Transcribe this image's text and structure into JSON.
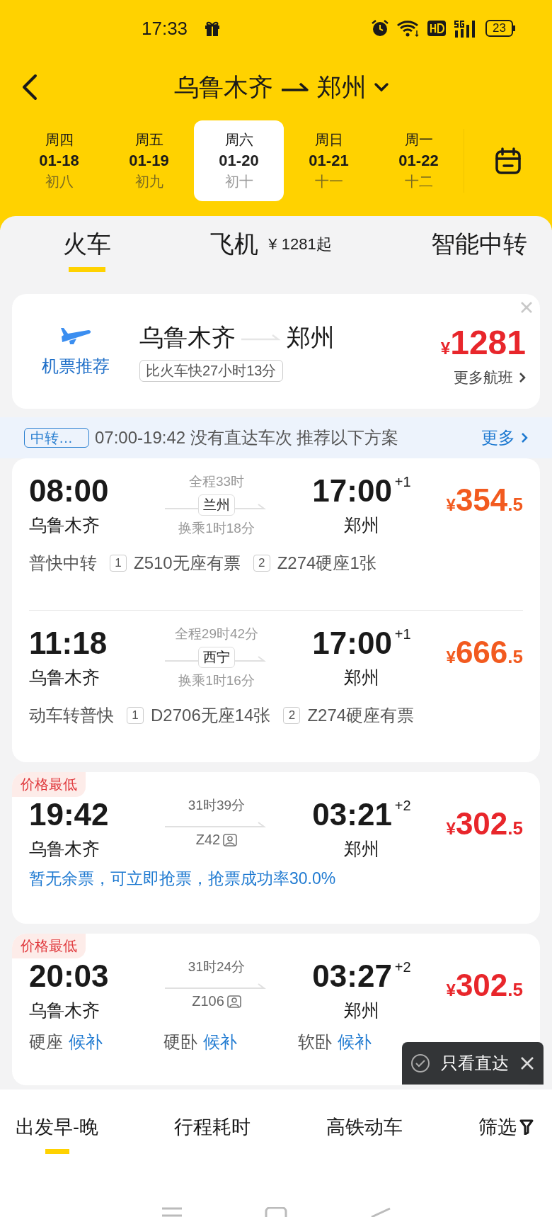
{
  "status_bar": {
    "time": "17:33",
    "battery": "23"
  },
  "header": {
    "from": "乌鲁木齐",
    "to": "郑州"
  },
  "dates": [
    {
      "weekday": "周四",
      "date": "01-18",
      "lunar": "初八",
      "selected": false
    },
    {
      "weekday": "周五",
      "date": "01-19",
      "lunar": "初九",
      "selected": false
    },
    {
      "weekday": "周六",
      "date": "01-20",
      "lunar": "初十",
      "selected": true
    },
    {
      "weekday": "周日",
      "date": "01-21",
      "lunar": "十一",
      "selected": false
    },
    {
      "weekday": "周一",
      "date": "01-22",
      "lunar": "十二",
      "selected": false
    }
  ],
  "mode_tabs": [
    {
      "label": "火车",
      "selected": true
    },
    {
      "label": "飞机",
      "note": "¥ 1281起",
      "selected": false
    },
    {
      "label": "智能中转",
      "selected": false
    }
  ],
  "flight_card": {
    "label": "机票推荐",
    "from": "乌鲁木齐",
    "to": "郑州",
    "badge": "比火车快27小时13分",
    "currency": "¥",
    "price": "1281",
    "more": "更多航班"
  },
  "transfer_notice": {
    "tag": "中转…",
    "text": "07:00-19:42 没有直达车次 推荐以下方案",
    "more": "更多"
  },
  "transfer_options": [
    {
      "depart_time": "08:00",
      "depart_station": "乌鲁木齐",
      "total": "全程33时",
      "via": "兰州",
      "transfer_time": "换乘1时18分",
      "arrive_time": "17:00",
      "day_offset": "+1",
      "arrive_station": "郑州",
      "currency": "¥",
      "price": "354",
      "price_decimal": ".5",
      "type": "普快中转",
      "legs": [
        {
          "index": "1",
          "text": "Z510无座有票"
        },
        {
          "index": "2",
          "text": "Z274硬座1张"
        }
      ]
    },
    {
      "depart_time": "11:18",
      "depart_station": "乌鲁木齐",
      "total": "全程29时42分",
      "via": "西宁",
      "transfer_time": "换乘1时16分",
      "arrive_time": "17:00",
      "day_offset": "+1",
      "arrive_station": "郑州",
      "currency": "¥",
      "price": "666",
      "price_decimal": ".5",
      "type": "动车转普快",
      "legs": [
        {
          "index": "1",
          "text": "D2706无座14张"
        },
        {
          "index": "2",
          "text": "Z274硬座有票"
        }
      ]
    }
  ],
  "trains": [
    {
      "badge": "价格最低",
      "depart_time": "19:42",
      "depart_station": "乌鲁木齐",
      "duration": "31时39分",
      "train_no": "Z42",
      "arrive_time": "03:21",
      "day_offset": "+2",
      "arrive_station": "郑州",
      "currency": "¥",
      "price": "302",
      "price_decimal": ".5",
      "kind": "notice",
      "notice": "暂无余票，可立即抢票，抢票成功率30.0%"
    },
    {
      "badge": "价格最低",
      "depart_time": "20:03",
      "depart_station": "乌鲁木齐",
      "duration": "31时24分",
      "train_no": "Z106",
      "arrive_time": "03:27",
      "day_offset": "+2",
      "arrive_station": "郑州",
      "currency": "¥",
      "price": "302",
      "price_decimal": ".5",
      "kind": "seats",
      "seats": [
        {
          "class": "硬座",
          "status": "候补"
        },
        {
          "class": "硬卧",
          "status": "候补"
        },
        {
          "class": "软卧",
          "status": "候补"
        }
      ]
    }
  ],
  "toast": {
    "label": "只看直达",
    "checked": false
  },
  "sort_bar": [
    {
      "label": "出发早-晚",
      "selected": true
    },
    {
      "label": "行程耗时",
      "selected": false
    },
    {
      "label": "高铁动车",
      "selected": false
    }
  ],
  "filter": {
    "label": "筛选"
  }
}
